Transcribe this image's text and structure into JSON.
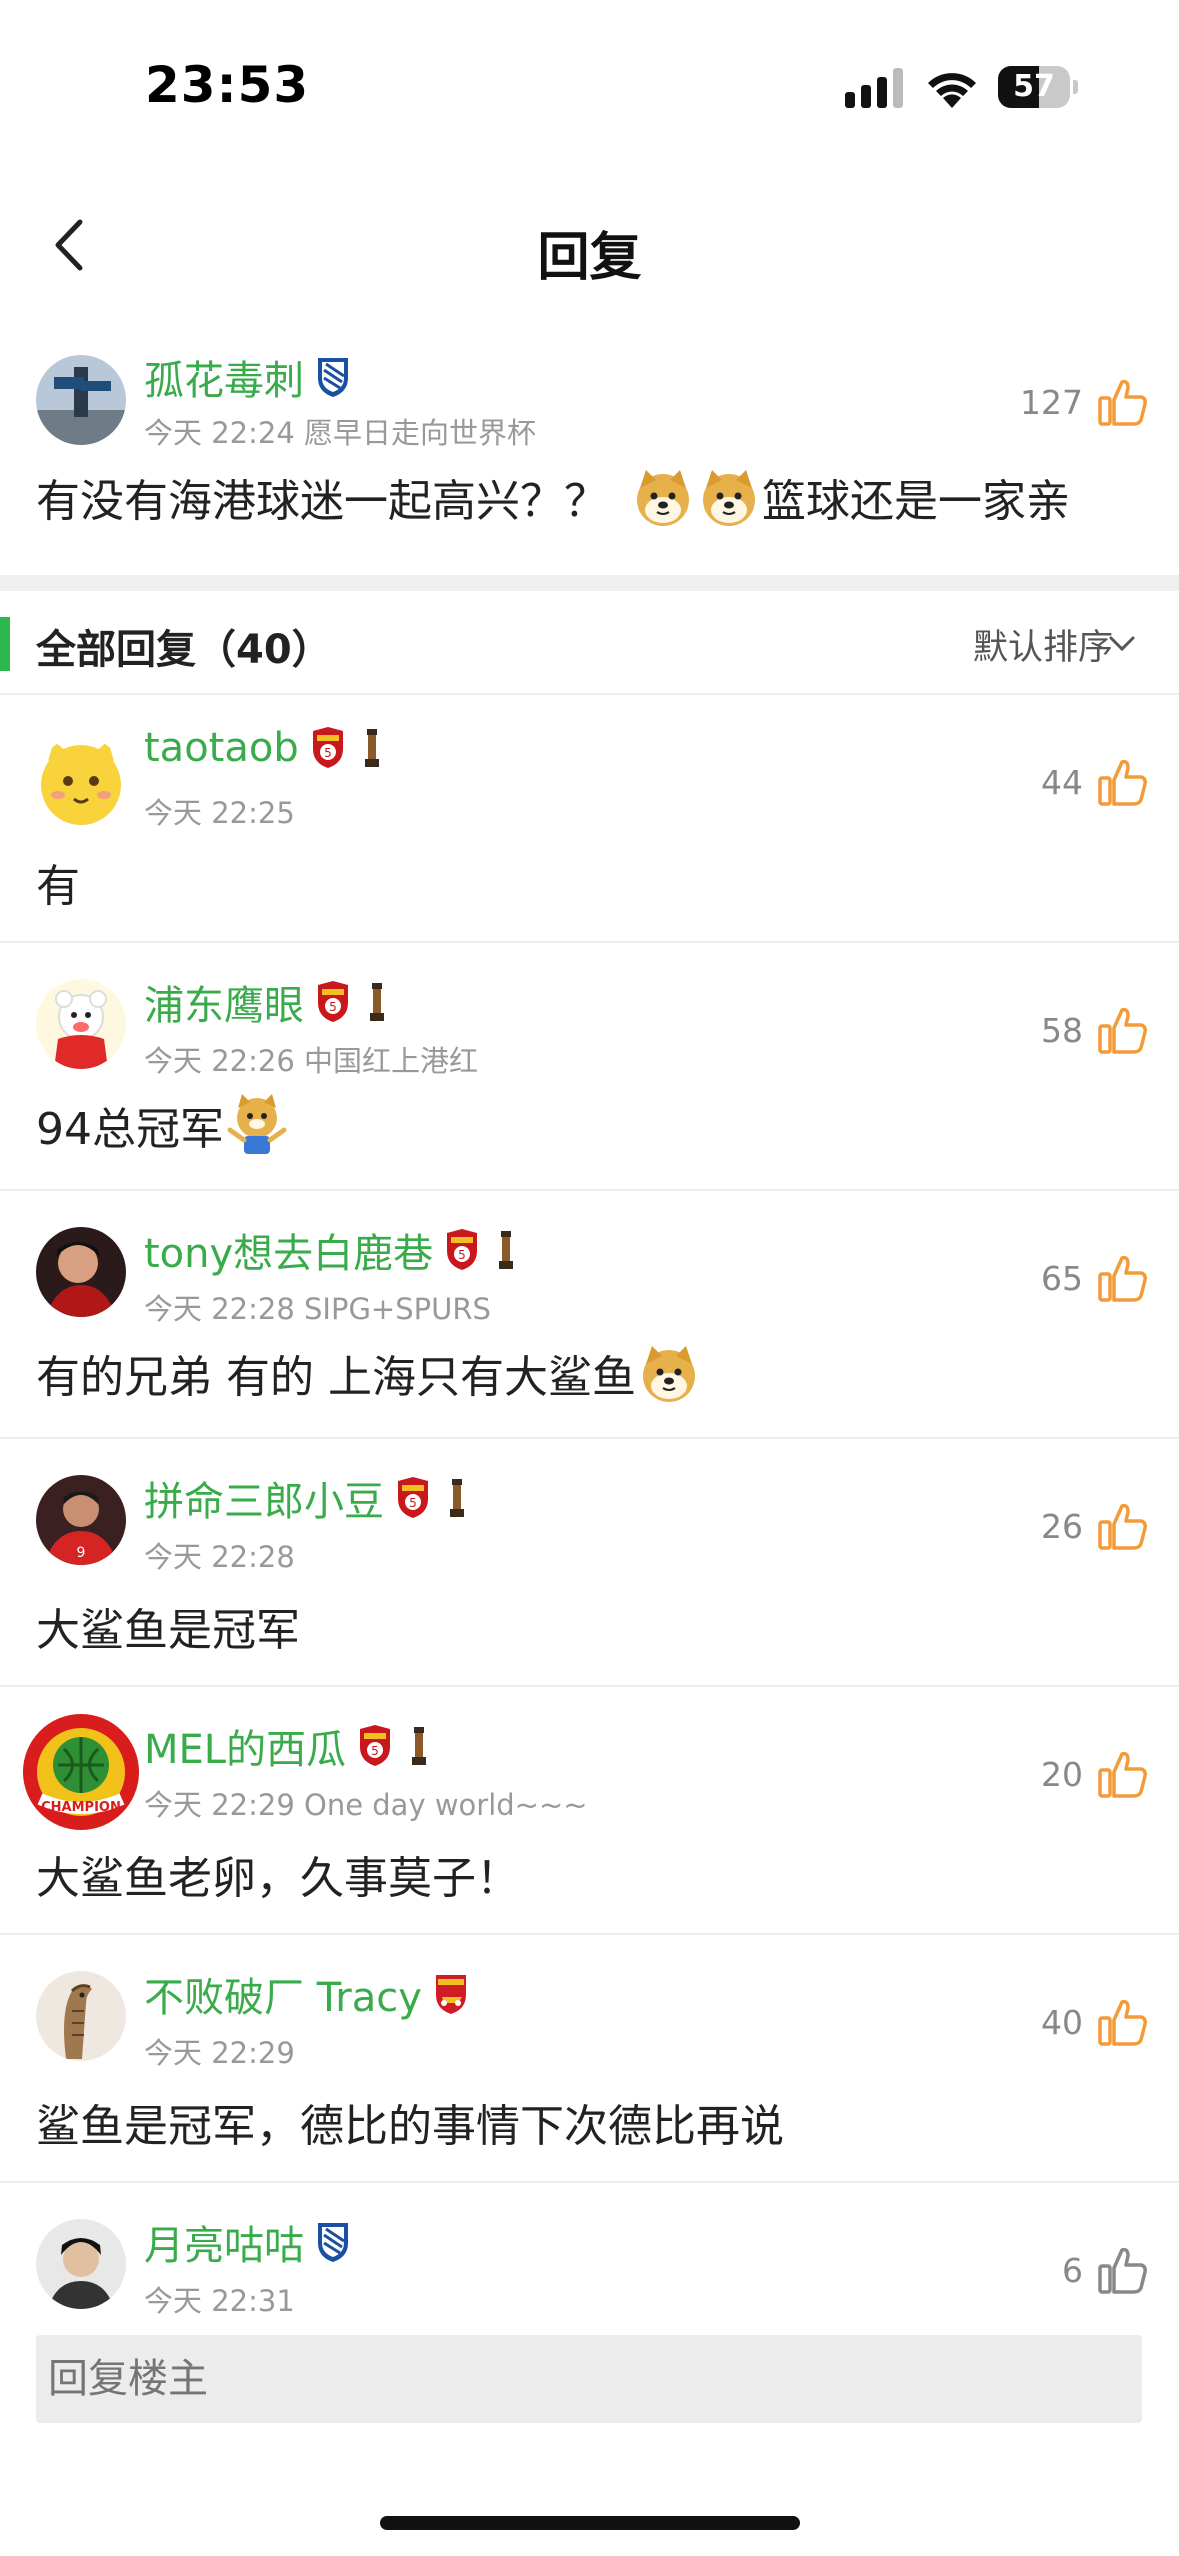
{
  "status_bar": {
    "time": "23:53",
    "battery": "57",
    "battery_fraction": 0.57
  },
  "nav": {
    "title": "回复"
  },
  "original_post": {
    "username": "孤花毒刺",
    "meta": "今天 22:24 愿早日走向世界杯",
    "likes": "127",
    "text_part1": "有没有海港球迷一起高兴？？",
    "text_part2": "篮球还是一家亲"
  },
  "section": {
    "title": "全部回复（40）",
    "sort_label": "默认排序"
  },
  "replies": [
    {
      "username": "taotaob",
      "meta": "今天 22:25",
      "likes": "44",
      "text": "有"
    },
    {
      "username": "浦东鹰眼",
      "meta": "今天 22:26 中国红上港红",
      "likes": "58",
      "text": "94总冠军"
    },
    {
      "username": "tony想去白鹿巷",
      "meta": "今天 22:28 SIPG+SPURS",
      "likes": "65",
      "text": "有的兄弟 有的 上海只有大鲨鱼"
    },
    {
      "username": "拼命三郎小豆",
      "meta": "今天 22:28",
      "likes": "26",
      "text": "大鲨鱼是冠军"
    },
    {
      "username": "MEL的西瓜",
      "meta": "今天 22:29 One day world~~~",
      "likes": "20",
      "text": "大鲨鱼老卵，久事莫子！"
    },
    {
      "username": "不败破厂 Tracy",
      "meta": "今天 22:29",
      "likes": "40",
      "text": "鲨鱼是冠军，德比的事情下次德比再说"
    },
    {
      "username": "月亮咕咕",
      "meta": "今天 22:31",
      "likes": "6",
      "text": ""
    }
  ],
  "reply_input": {
    "placeholder": "回复楼主"
  },
  "colors": {
    "username_green": "#3aab4b",
    "accent_green": "#2db84b",
    "like_orange": "#f29b38"
  }
}
